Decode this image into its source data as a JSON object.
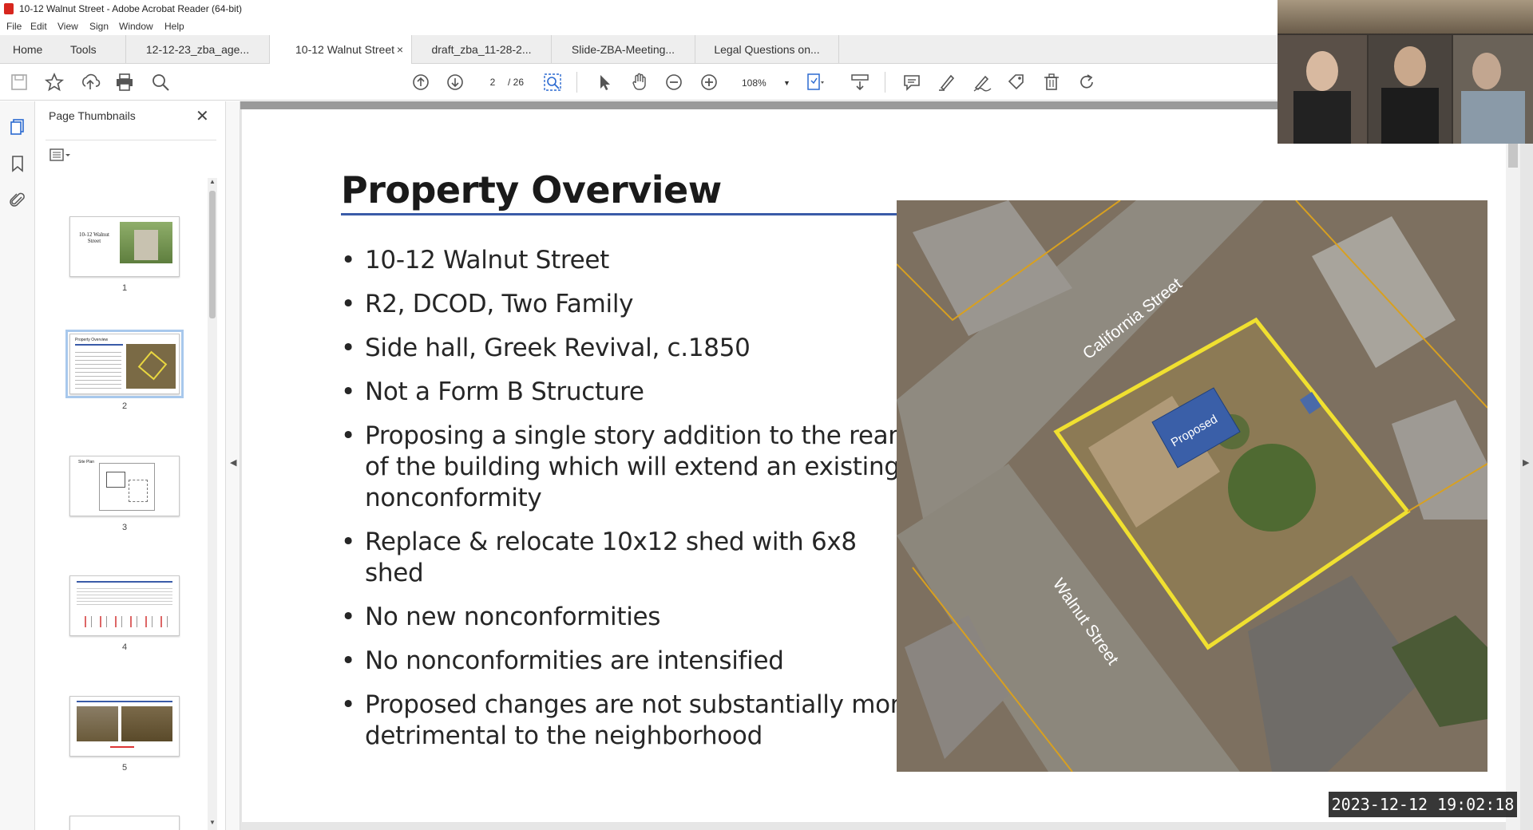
{
  "window": {
    "title": "10-12 Walnut Street - Adobe Acrobat Reader (64-bit)"
  },
  "menu": [
    "File",
    "Edit",
    "View",
    "Sign",
    "Window",
    "Help"
  ],
  "tabs": {
    "home": "Home",
    "tools": "Tools",
    "documents": [
      "12-12-23_zba_age...",
      "10-12 Walnut Street",
      "draft_zba_11-28-2...",
      "Slide-ZBA-Meeting...",
      "Legal Questions on..."
    ],
    "close_glyph": "×"
  },
  "toolbar": {
    "current_page": "2",
    "page_count": "/ 26",
    "zoom": "108%",
    "icons": [
      "save-icon",
      "star-icon",
      "upload-icon",
      "print-icon",
      "search-icon",
      "prev-page-icon",
      "next-page-icon",
      "find-icon",
      "select-arrow-icon",
      "hand-icon",
      "zoom-out-icon",
      "zoom-in-icon",
      "fit-page-icon",
      "scroll-mode-icon",
      "comment-icon",
      "highlight-icon",
      "sign-icon",
      "stamp-icon",
      "delete-icon",
      "rotate-icon"
    ]
  },
  "sidebar": {
    "panel_title": "Page Thumbnails",
    "thumbnails": [
      {
        "label": "1",
        "title": "10-12 Walnut Street"
      },
      {
        "label": "2",
        "title": "Property Overview"
      },
      {
        "label": "3",
        "title": "Site Plan"
      },
      {
        "label": "4",
        "title": ""
      },
      {
        "label": "5",
        "title": ""
      }
    ]
  },
  "slide": {
    "title": "Property Overview",
    "bullets": [
      "10-12 Walnut Street",
      "R2, DCOD, Two Family",
      "Side hall, Greek Revival, c.1850",
      "Not a Form B Structure",
      "Proposing a single story addition to the rear of the building which will extend an existing nonconformity",
      "Replace & relocate 10x12 shed with 6x8 shed",
      "No new nonconformities",
      "No nonconformities are intensified",
      "Proposed changes are not substantially more detrimental to the neighborhood"
    ],
    "map_labels": {
      "street_1": "California Street",
      "street_2": "Walnut Street",
      "proposed": "Proposed"
    }
  },
  "overlay": {
    "timestamp": "2023-12-12 19:02:18"
  },
  "colors": {
    "accent_blue": "#3a5ba8",
    "lot_outline": "#f0e030",
    "proposed_fill": "#3a5fa8"
  }
}
